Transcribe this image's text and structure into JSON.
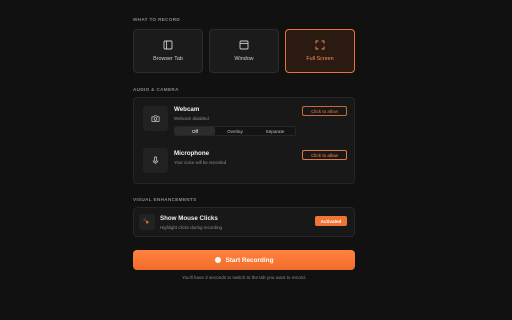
{
  "sections": {
    "record": "WHAT TO RECORD",
    "audio": "AUDIO & CAMERA",
    "visual": "VISUAL ENHANCEMENTS"
  },
  "modes": [
    {
      "label": "Browser Tab",
      "icon": "browser-tab-icon"
    },
    {
      "label": "Window",
      "icon": "window-icon"
    },
    {
      "label": "Full Screen",
      "icon": "full-screen-icon",
      "active": true
    }
  ],
  "webcam": {
    "title": "Webcam",
    "subtitle": "Webcam disabled",
    "button": "Click to allow",
    "options": [
      "Off",
      "Overlay",
      "Separate"
    ],
    "selected": "Off"
  },
  "microphone": {
    "title": "Microphone",
    "subtitle": "Your voice will be recorded",
    "button": "Click to allow"
  },
  "mouse_clicks": {
    "title": "Show Mouse Clicks",
    "subtitle": "Highlight clicks during recording",
    "badge": "Activated"
  },
  "start": {
    "label": "Start Recording",
    "note": "You'll have 3 seconds to switch to the tab you want to record."
  },
  "colors": {
    "accent": "#f07535",
    "background": "#111111",
    "card": "#181818"
  }
}
